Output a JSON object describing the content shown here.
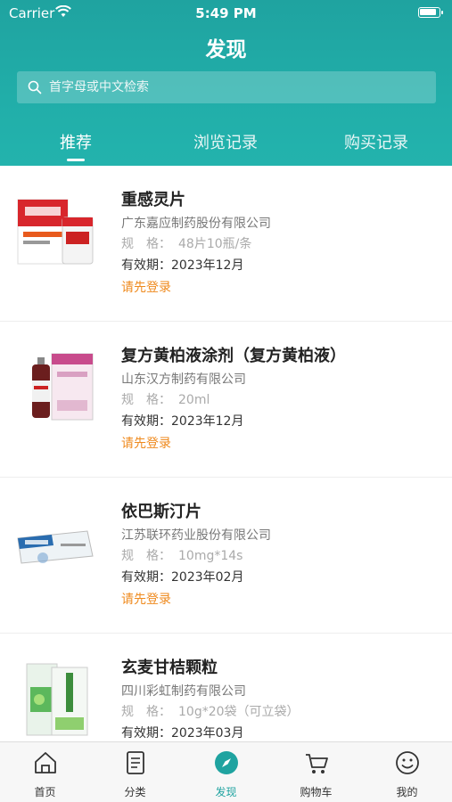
{
  "status_bar": {
    "carrier": "Carrier",
    "time": "5:49 PM"
  },
  "header": {
    "title": "发现",
    "search_placeholder": "首字母或中文检索",
    "tabs": [
      {
        "label": "推荐",
        "active": true
      },
      {
        "label": "浏览记录",
        "active": false
      },
      {
        "label": "购买记录",
        "active": false
      }
    ]
  },
  "products": [
    {
      "name": "重感灵片",
      "company": "广东嘉应制药股份有限公司",
      "spec_label": "规　格：",
      "spec": "48片10瓶/条",
      "expiry_label": "有效期：",
      "expiry": "2023年12月",
      "login": "请先登录"
    },
    {
      "name": "复方黄柏液涂剂（复方黄柏液）",
      "company": "山东汉方制药有限公司",
      "spec_label": "规　格：",
      "spec": "20ml",
      "expiry_label": "有效期：",
      "expiry": "2023年12月",
      "login": "请先登录"
    },
    {
      "name": "依巴斯汀片",
      "company": "江苏联环药业股份有限公司",
      "spec_label": "规　格：",
      "spec": "10mg*14s",
      "expiry_label": "有效期：",
      "expiry": "2023年02月",
      "login": "请先登录"
    },
    {
      "name": "玄麦甘桔颗粒",
      "company": "四川彩虹制药有限公司",
      "spec_label": "规　格：",
      "spec": "10g*20袋（可立袋）",
      "expiry_label": "有效期：",
      "expiry": "2023年03月",
      "login": ""
    }
  ],
  "tabbar": [
    {
      "label": "首页",
      "icon": "home-icon",
      "active": false
    },
    {
      "label": "分类",
      "icon": "category-icon",
      "active": false
    },
    {
      "label": "发现",
      "icon": "compass-icon",
      "active": true
    },
    {
      "label": "购物车",
      "icon": "cart-icon",
      "active": false
    },
    {
      "label": "我的",
      "icon": "profile-icon",
      "active": false
    }
  ],
  "colors": {
    "primary": "#1fa3a0",
    "accent": "#ef8a1e"
  }
}
